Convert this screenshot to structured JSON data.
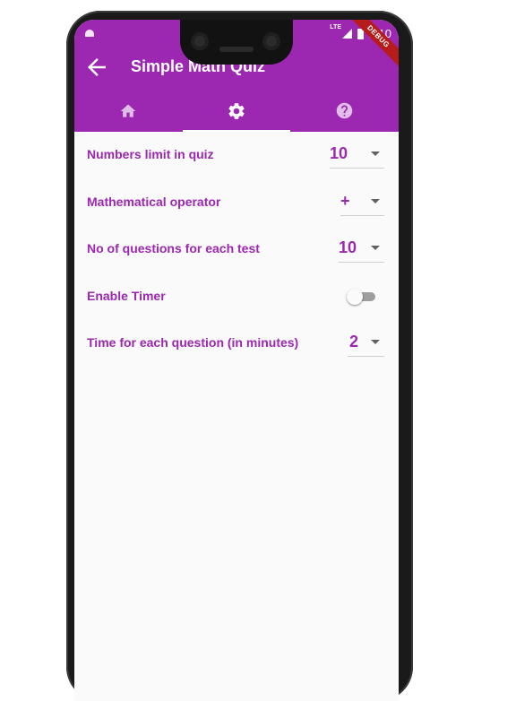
{
  "status_bar": {
    "time": "2:10",
    "network": "LTE",
    "debug_label": "DEBUG"
  },
  "app_bar": {
    "title": "Simple Math Quiz",
    "color": "#9c27b0"
  },
  "tabs": [
    {
      "name": "home",
      "icon": "home-icon",
      "selected": false
    },
    {
      "name": "settings",
      "icon": "gear-icon",
      "selected": true
    },
    {
      "name": "help",
      "icon": "help-icon",
      "selected": false
    }
  ],
  "settings": {
    "numbers_limit": {
      "label": "Numbers limit in quiz",
      "value": "10"
    },
    "operator": {
      "label": "Mathematical operator",
      "value": "+"
    },
    "question_count": {
      "label": "No of questions for each test",
      "value": "10"
    },
    "timer": {
      "label": "Enable Timer",
      "enabled": false
    },
    "time_per_question": {
      "label": "Time for each question (in minutes)",
      "value": "2"
    }
  },
  "colors": {
    "accent": "#9c27b0",
    "background": "#fafafa"
  }
}
